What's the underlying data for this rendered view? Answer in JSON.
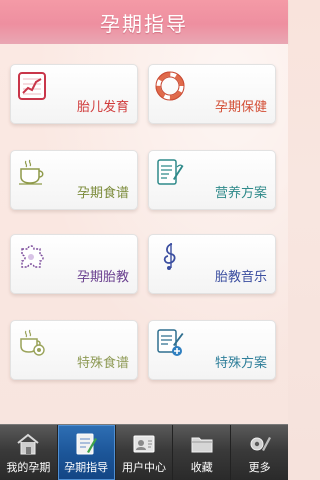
{
  "header": {
    "title": "孕期指导"
  },
  "tiles": [
    {
      "label": "胎儿发育",
      "icon": "chart-icon",
      "color": "#d03a3a"
    },
    {
      "label": "孕期保健",
      "icon": "lifebuoy-icon",
      "color": "#d34f36"
    },
    {
      "label": "孕期食谱",
      "icon": "coffee-cup-icon",
      "color": "#7b8b3a"
    },
    {
      "label": "营养方案",
      "icon": "notepad-icon",
      "color": "#2f8a8a"
    },
    {
      "label": "孕期胎教",
      "icon": "puzzle-icon",
      "color": "#6a3f8f"
    },
    {
      "label": "胎教音乐",
      "icon": "music-note-icon",
      "color": "#3b4ea0"
    },
    {
      "label": "特殊食谱",
      "icon": "special-cup-icon",
      "color": "#8e9a55"
    },
    {
      "label": "特殊方案",
      "icon": "special-notepad-icon",
      "color": "#2f7f9a"
    }
  ],
  "tabbar": {
    "tabs": [
      {
        "label": "我的孕期",
        "icon": "house-icon",
        "active": false
      },
      {
        "label": "孕期指导",
        "icon": "guide-book-icon",
        "active": true
      },
      {
        "label": "用户中心",
        "icon": "user-center-icon",
        "active": false
      },
      {
        "label": "收藏",
        "icon": "folder-icon",
        "active": false
      },
      {
        "label": "更多",
        "icon": "more-tools-icon",
        "active": false
      }
    ]
  }
}
